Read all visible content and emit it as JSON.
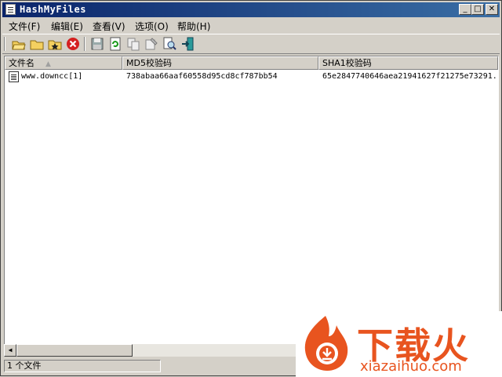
{
  "window": {
    "title": "HashMyFiles",
    "controls": {
      "minimize": "_",
      "maximize": "□",
      "close": "✕"
    }
  },
  "menu": [
    {
      "label": "文件(F)"
    },
    {
      "label": "编辑(E)"
    },
    {
      "label": "查看(V)"
    },
    {
      "label": "选项(O)"
    },
    {
      "label": "帮助(H)"
    }
  ],
  "toolbar": [
    {
      "icon": "open-file-icon"
    },
    {
      "icon": "open-folder-icon"
    },
    {
      "icon": "favorites-icon"
    },
    {
      "icon": "delete-icon"
    },
    {
      "icon": "save-icon"
    },
    {
      "icon": "refresh-icon"
    },
    {
      "icon": "copy-icon"
    },
    {
      "icon": "properties-icon"
    },
    {
      "icon": "find-icon"
    },
    {
      "icon": "exit-icon"
    }
  ],
  "list": {
    "columns": [
      {
        "label": "文件名"
      },
      {
        "label": "MD5校验码"
      },
      {
        "label": "SHA1校验码"
      }
    ],
    "rows": [
      {
        "filename": "www.downcc[1]",
        "md5": "738abaa66aaf60558d95cd8cf787bb54",
        "sha1": "65e2847740646aea21941627f21275e73291..."
      }
    ]
  },
  "status": {
    "count": "1 个文件"
  },
  "watermark": {
    "text": "下载火",
    "url": "xiazaihuo.com",
    "color": "#e8541f"
  }
}
